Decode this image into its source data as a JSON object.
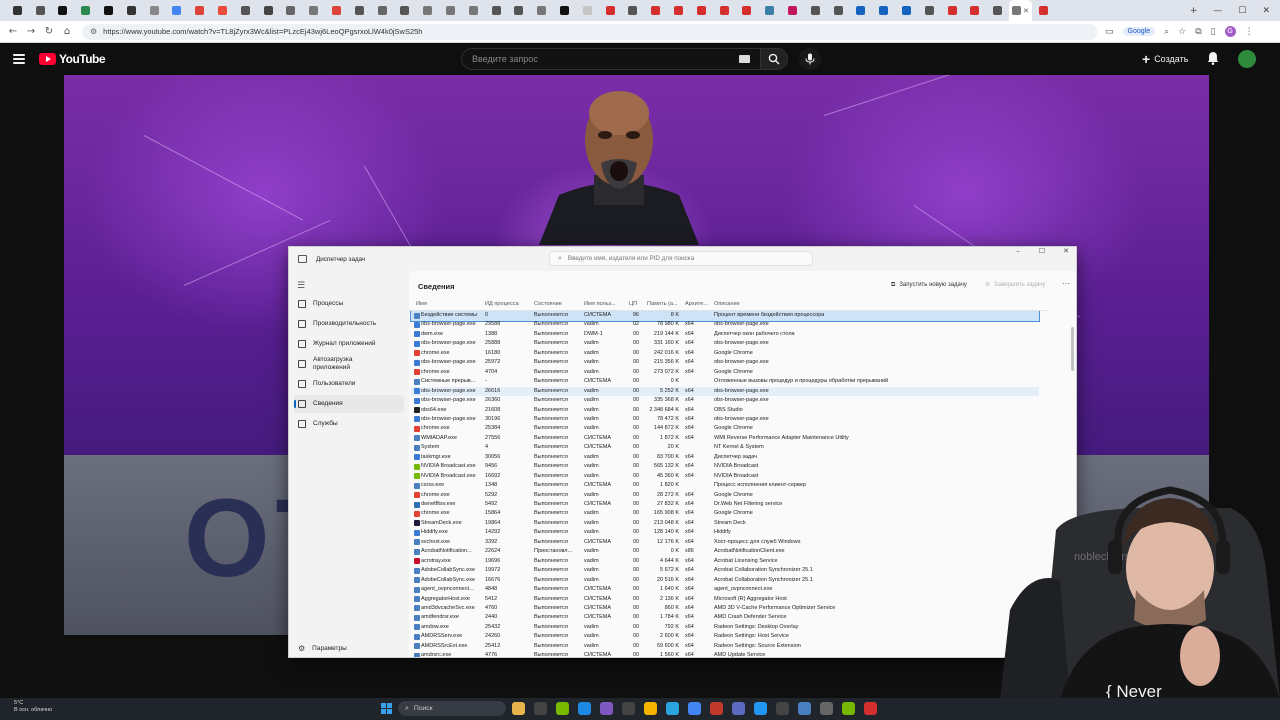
{
  "browser": {
    "url": "https://www.youtube.com/watch?v=TL8jZyrx3Wc&list=PLzcEj43wj6LeoQPgsrxoLlW4k0jSwS25h",
    "google_pill": "Google",
    "profile_letter": "G",
    "tab_colors": [
      "#333",
      "#555",
      "#111",
      "#2d8a4e",
      "#111",
      "#333",
      "#888",
      "#4285f4",
      "#db4437",
      "#e84b3c",
      "#555",
      "#444",
      "#666",
      "#777",
      "#db4437",
      "#555",
      "#666",
      "#555",
      "#777",
      "#777",
      "#777",
      "#555",
      "#555",
      "#777",
      "#111",
      "#c6c6c6",
      "#d32f2f",
      "#555",
      "#d32f2f",
      "#d32f2f",
      "#d32f2f",
      "#d32f2f",
      "#d32f2f",
      "#3b7fa6",
      "#c2185b",
      "#555",
      "#555",
      "#1565c0",
      "#1565c0",
      "#1565c0",
      "#555",
      "#d32f2f",
      "#d32f2f",
      "#555",
      "#777",
      "#d32f2f"
    ],
    "active_tab_index": 44
  },
  "youtube": {
    "logo_text": "YouTube",
    "search_placeholder": "Введите запрос",
    "create_label": "Создать"
  },
  "video": {
    "overlay_text": "ОТ"
  },
  "task_manager": {
    "title": "Диспетчер задач",
    "search_placeholder": "Введите имя, издателя или PID для поиска",
    "section_heading": "Сведения",
    "run_new_task": "Запустить новую задачу",
    "end_task": "Завершить задачу",
    "nav": [
      {
        "label": "Процессы",
        "selected": false
      },
      {
        "label": "Производительность",
        "selected": false
      },
      {
        "label": "Журнал приложений",
        "selected": false
      },
      {
        "label": "Автозагрузка",
        "label2": "приложений",
        "selected": false
      },
      {
        "label": "Пользователи",
        "selected": false
      },
      {
        "label": "Сведения",
        "selected": true
      },
      {
        "label": "Службы",
        "selected": false
      }
    ],
    "settings_label": "Параметры",
    "columns": [
      "Имя",
      "ИД процесса",
      "Состояние",
      "Имя польз...",
      "ЦП",
      "Память (а...",
      "Архите...",
      "Описание"
    ],
    "rows": [
      [
        "Бездействие системы",
        "0",
        "Выполняется",
        "СИСТЕМА",
        "96",
        "8 K",
        "",
        "Процент времени бездействия процессора"
      ],
      [
        "obs-browser-page.exe",
        "29588",
        "Выполняется",
        "vadim",
        "02",
        "78 980 K",
        "x64",
        "obs-browser-page.exe"
      ],
      [
        "dwm.exe",
        "1388",
        "Выполняется",
        "DWM-1",
        "00",
        "219 144 K",
        "x64",
        "Диспетчер окон рабочего стола"
      ],
      [
        "obs-browser-page.exe",
        "25888",
        "Выполняется",
        "vadim",
        "00",
        "331 160 K",
        "x64",
        "obs-browser-page.exe"
      ],
      [
        "chrome.exe",
        "16180",
        "Выполняется",
        "vadim",
        "00",
        "242 016 K",
        "x64",
        "Google Chrome"
      ],
      [
        "obs-browser-page.exe",
        "25972",
        "Выполняется",
        "vadim",
        "00",
        "215 356 K",
        "x64",
        "obs-browser-page.exe"
      ],
      [
        "chrome.exe",
        "4704",
        "Выполняется",
        "vadim",
        "00",
        "273 072 K",
        "x64",
        "Google Chrome"
      ],
      [
        "Системные прерыв...",
        "-",
        "Выполняется",
        "СИСТЕМА",
        "00",
        "0 K",
        "",
        "Отложенные вызовы процедур и процедуры обработки прерываний"
      ],
      [
        "obs-browser-page.exe",
        "26616",
        "Выполняется",
        "vadim",
        "00",
        "5 252 K",
        "x64",
        "obs-browser-page.exe"
      ],
      [
        "obs-browser-page.exe",
        "26360",
        "Выполняется",
        "vadim",
        "00",
        "335 368 K",
        "x64",
        "obs-browser-page.exe"
      ],
      [
        "obs64.exe",
        "21608",
        "Выполняется",
        "vadim",
        "00",
        "2 348 684 K",
        "x64",
        "OBS Studio"
      ],
      [
        "obs-browser-page.exe",
        "30196",
        "Выполняется",
        "vadim",
        "00",
        "78 472 K",
        "x64",
        "obs-browser-page.exe"
      ],
      [
        "chrome.exe",
        "25384",
        "Выполняется",
        "vadim",
        "00",
        "144 872 K",
        "x64",
        "Google Chrome"
      ],
      [
        "WMIADAP.exe",
        "27556",
        "Выполняется",
        "СИСТЕМА",
        "00",
        "1 872 K",
        "x64",
        "WMI Reverse Performance Adapter Maintenance Utility"
      ],
      [
        "System",
        "4",
        "Выполняется",
        "СИСТЕМА",
        "00",
        "20 K",
        "",
        "NT Kernel & System"
      ],
      [
        "taskmgr.exe",
        "30056",
        "Выполняется",
        "vadim",
        "00",
        "83 700 K",
        "x64",
        "Диспетчер задач"
      ],
      [
        "NVIDIA Broadcast.exe",
        "9456",
        "Выполняется",
        "vadim",
        "00",
        "565 132 K",
        "x64",
        "NVIDIA Broadcast"
      ],
      [
        "NVIDIA Broadcast.exe",
        "16692",
        "Выполняется",
        "vadim",
        "00",
        "45 360 K",
        "x64",
        "NVIDIA Broadcast"
      ],
      [
        "csrss.exe",
        "1348",
        "Выполняется",
        "СИСТЕМА",
        "00",
        "1 820 K",
        "",
        "Процесс исполнения клиент-сервер"
      ],
      [
        "chrome.exe",
        "5292",
        "Выполняется",
        "vadim",
        "00",
        "28 272 K",
        "x64",
        "Google Chrome"
      ],
      [
        "dwnetfltsv.exe",
        "5492",
        "Выполняется",
        "СИСТЕМА",
        "00",
        "27 832 K",
        "x64",
        "Dr.Web Net Filtering service"
      ],
      [
        "chrome.exe",
        "15864",
        "Выполняется",
        "vadim",
        "00",
        "165 908 K",
        "x64",
        "Google Chrome"
      ],
      [
        "StreamDeck.exe",
        "19864",
        "Выполняется",
        "vadim",
        "00",
        "213 048 K",
        "x64",
        "Stream Deck"
      ],
      [
        "Hiddify.exe",
        "14292",
        "Выполняется",
        "vadim",
        "00",
        "128 140 K",
        "x64",
        "Hiddify"
      ],
      [
        "svchost.exe",
        "3392",
        "Выполняется",
        "СИСТЕМА",
        "00",
        "12 176 K",
        "x64",
        "Хост-процесс для служб Windows"
      ],
      [
        "AcrobatNotification...",
        "22624",
        "Приостановл...",
        "vadim",
        "00",
        "0 K",
        "x86",
        "AcrobatNotificationClient.exe"
      ],
      [
        "acrotray.exe",
        "19696",
        "Выполняется",
        "vadim",
        "00",
        "4 644 K",
        "x64",
        "Acrobat Licensing Service"
      ],
      [
        "AdobeCollabSync.exe",
        "19972",
        "Выполняется",
        "vadim",
        "00",
        "5 672 K",
        "x64",
        "Acrobat Collaboration Synchronizer 25.1"
      ],
      [
        "AdobeCollabSync.exe",
        "16676",
        "Выполняется",
        "vadim",
        "00",
        "20 516 K",
        "x64",
        "Acrobat Collaboration Synchronizer 25.1"
      ],
      [
        "agent_ovpnconnect...",
        "4848",
        "Выполняется",
        "СИСТЕМА",
        "00",
        "1 640 K",
        "x64",
        "agent_ovpnconnect.exe"
      ],
      [
        "AggregatorHost.exe",
        "5412",
        "Выполняется",
        "СИСТЕМА",
        "00",
        "2 136 K",
        "x64",
        "Microsoft (R) Aggregator Host"
      ],
      [
        "amd3dvcacheSvc.exe",
        "4760",
        "Выполняется",
        "СИСТЕМА",
        "00",
        "860 K",
        "x64",
        "AMD 3D V-Cache Performance Optimizer Service"
      ],
      [
        "amdfendrsr.exe",
        "2440",
        "Выполняется",
        "СИСТЕМА",
        "00",
        "1 784 K",
        "x64",
        "AMD Crash Defender Service"
      ],
      [
        "amdow.exe",
        "25432",
        "Выполняется",
        "vadim",
        "00",
        "792 K",
        "x64",
        "Radeon Settings: Desktop Overlay"
      ],
      [
        "AMDRSServ.exe",
        "24260",
        "Выполняется",
        "vadim",
        "00",
        "2 600 K",
        "x64",
        "Radeon Settings: Host Service"
      ],
      [
        "AMDRSSrcExt.exe",
        "25412",
        "Выполняется",
        "vadim",
        "00",
        "59 600 K",
        "x64",
        "Radeon Settings: Source Extension"
      ],
      [
        "amdrsrc.exe",
        "4776",
        "Выполняется",
        "СИСТЕМА",
        "00",
        "1 560 K",
        "x64",
        "AMD Update Service"
      ]
    ],
    "row_icon_colors": [
      "#4a7fc1",
      "#3a7bd5",
      "#3a7bd5",
      "#3a7bd5",
      "#e34133",
      "#3a7bd5",
      "#e34133",
      "#4a7fc1",
      "#3a7bd5",
      "#3a7bd5",
      "#222",
      "#3a7bd5",
      "#e34133",
      "#4a7fc1",
      "#4a7fc1",
      "#3a7bd5",
      "#76b900",
      "#76b900",
      "#4a7fc1",
      "#e34133",
      "#2f6fb3",
      "#e34133",
      "#1c1c3a",
      "#3a7bd5",
      "#4a7fc1",
      "#4a7fc1",
      "#c8102e",
      "#4a7fc1",
      "#4a7fc1",
      "#4a7fc1",
      "#4a7fc1",
      "#4a7fc1",
      "#4a7fc1",
      "#4a7fc1",
      "#4a7fc1",
      "#4a7fc1",
      "#4a7fc1"
    ],
    "selected_row": 0,
    "hover_row": 8
  },
  "webcam": {
    "shirt_text": "{ Never",
    "chair_text": "noblechairs"
  },
  "taskbar": {
    "temperature": "5°C",
    "weather": "В осн. облачно",
    "search_label": "Поиск",
    "icon_colors": [
      "#e8b34a",
      "#444",
      "#76b900",
      "#1e88e5",
      "#7e57c2",
      "#444",
      "#f4b400",
      "#2aa5e0",
      "#4285f4",
      "#c0392b",
      "#5c6bc0",
      "#2196f3",
      "#444",
      "#4a7fc1",
      "#666",
      "#76b900",
      "#d32f2f"
    ]
  }
}
